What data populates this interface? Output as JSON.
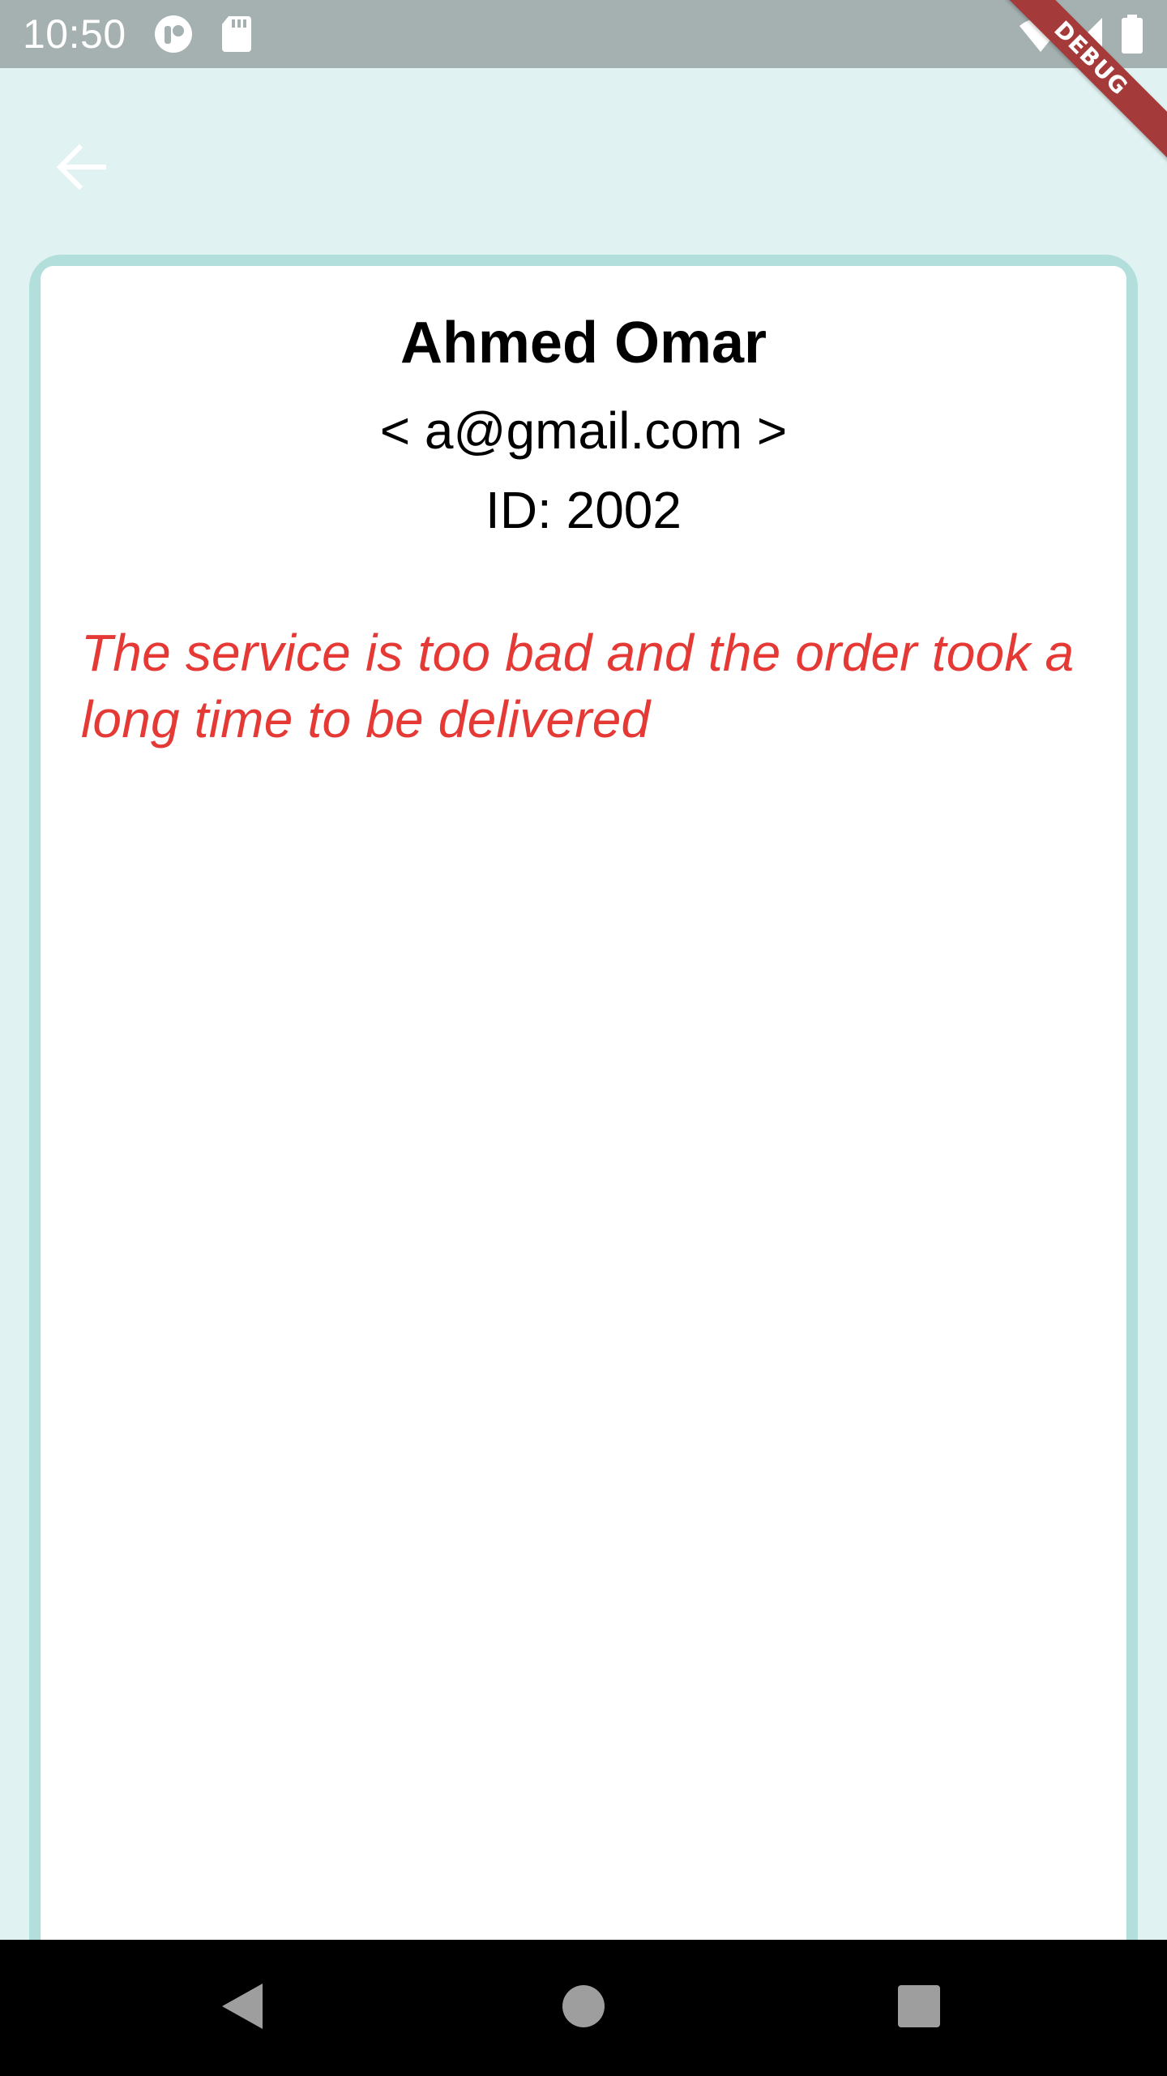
{
  "status_bar": {
    "time": "10:50",
    "left_icons": [
      "profile-badge-icon",
      "sd-card-icon"
    ],
    "right_icons": [
      "wifi-icon",
      "signal-icon",
      "battery-icon"
    ]
  },
  "debug_banner": {
    "label": "DEBUG"
  },
  "app_bar": {
    "back_icon": "back-arrow-icon"
  },
  "card": {
    "name": "Ahmed Omar",
    "email": "< a@gmail.com >",
    "id_text": "ID: 2002",
    "complaint": "The service is too bad and the order took a long time to be delivered"
  },
  "nav_bar": {
    "buttons": [
      "nav-back-icon",
      "nav-home-icon",
      "nav-recents-icon"
    ]
  },
  "colors": {
    "status_bar": "#a4b1b0",
    "background": "#e0f2f1",
    "card_border": "#b2dfdb",
    "card": "#ffffff",
    "complaint_text": "#e53935",
    "debug_banner": "#a53a3a",
    "nav_bar": "#000000"
  }
}
